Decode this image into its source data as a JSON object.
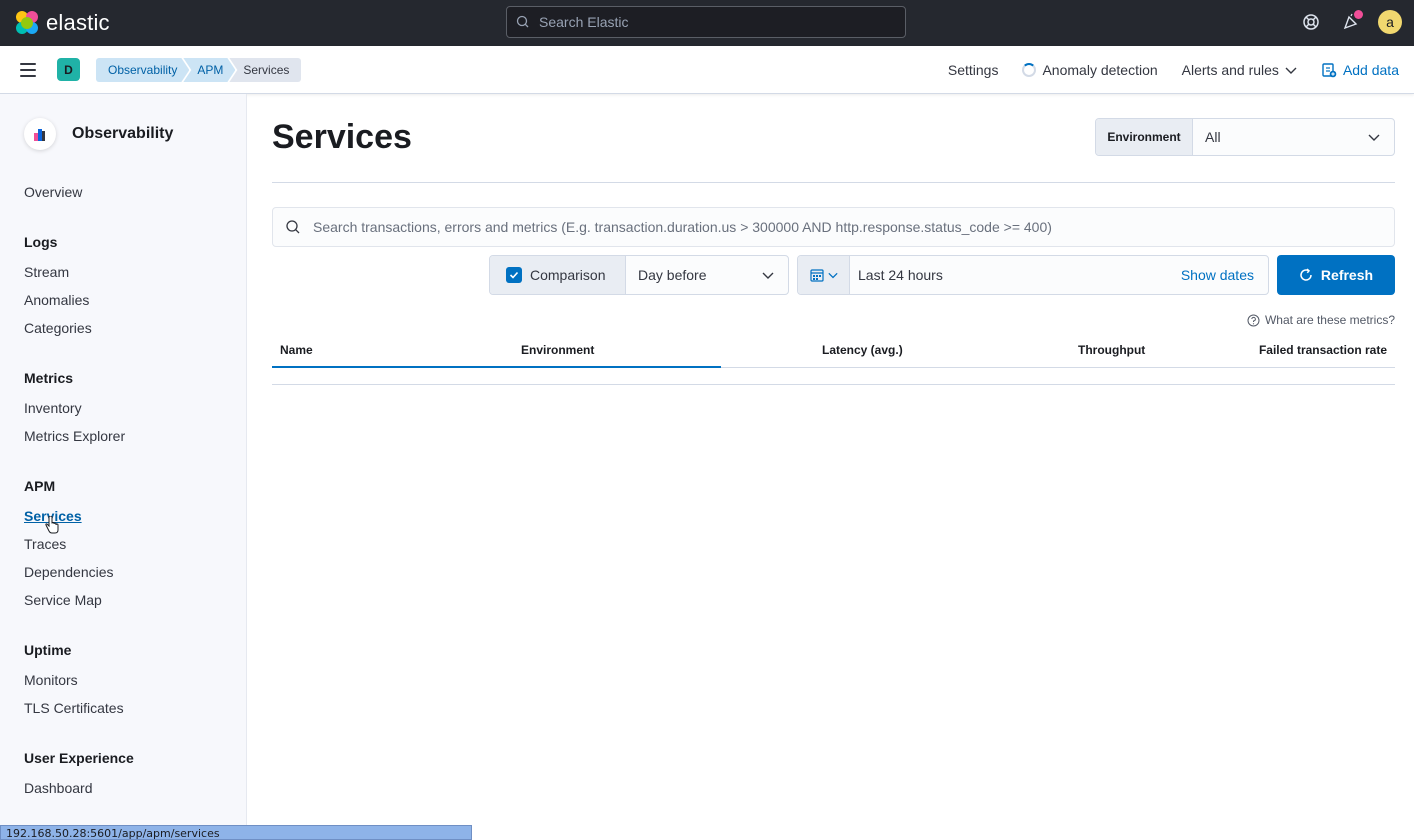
{
  "header": {
    "brand": "elastic",
    "search_placeholder": "Search Elastic",
    "avatar_initial": "a"
  },
  "subheader": {
    "space_initial": "D",
    "breadcrumbs": [
      "Observability",
      "APM",
      "Services"
    ],
    "links": {
      "settings": "Settings",
      "anomaly": "Anomaly detection",
      "alerts": "Alerts and rules",
      "add_data": "Add data"
    }
  },
  "sidebar": {
    "title": "Observability",
    "overview": "Overview",
    "sections": [
      {
        "heading": "Logs",
        "items": [
          "Stream",
          "Anomalies",
          "Categories"
        ]
      },
      {
        "heading": "Metrics",
        "items": [
          "Inventory",
          "Metrics Explorer"
        ]
      },
      {
        "heading": "APM",
        "items": [
          "Services",
          "Traces",
          "Dependencies",
          "Service Map"
        ]
      },
      {
        "heading": "Uptime",
        "items": [
          "Monitors",
          "TLS Certificates"
        ]
      },
      {
        "heading": "User Experience",
        "items": [
          "Dashboard"
        ]
      }
    ]
  },
  "main": {
    "title": "Services",
    "environment": {
      "label": "Environment",
      "value": "All"
    },
    "search_placeholder": "Search transactions, errors and metrics (E.g. transaction.duration.us > 300000 AND http.response.status_code >= 400)",
    "comparison": {
      "label": "Comparison",
      "checked": true,
      "value": "Day before"
    },
    "date": {
      "value": "Last 24 hours",
      "show_dates": "Show dates"
    },
    "refresh_label": "Refresh",
    "help_text": "What are these metrics?",
    "columns": [
      "Name",
      "Environment",
      "Latency (avg.)",
      "Throughput",
      "Failed transaction rate"
    ]
  },
  "status_url": "192.168.50.28:5601/app/apm/services",
  "colors": {
    "accent": "#0071c2",
    "header_bg": "#25282f",
    "space_badge": "#20b2a7"
  }
}
